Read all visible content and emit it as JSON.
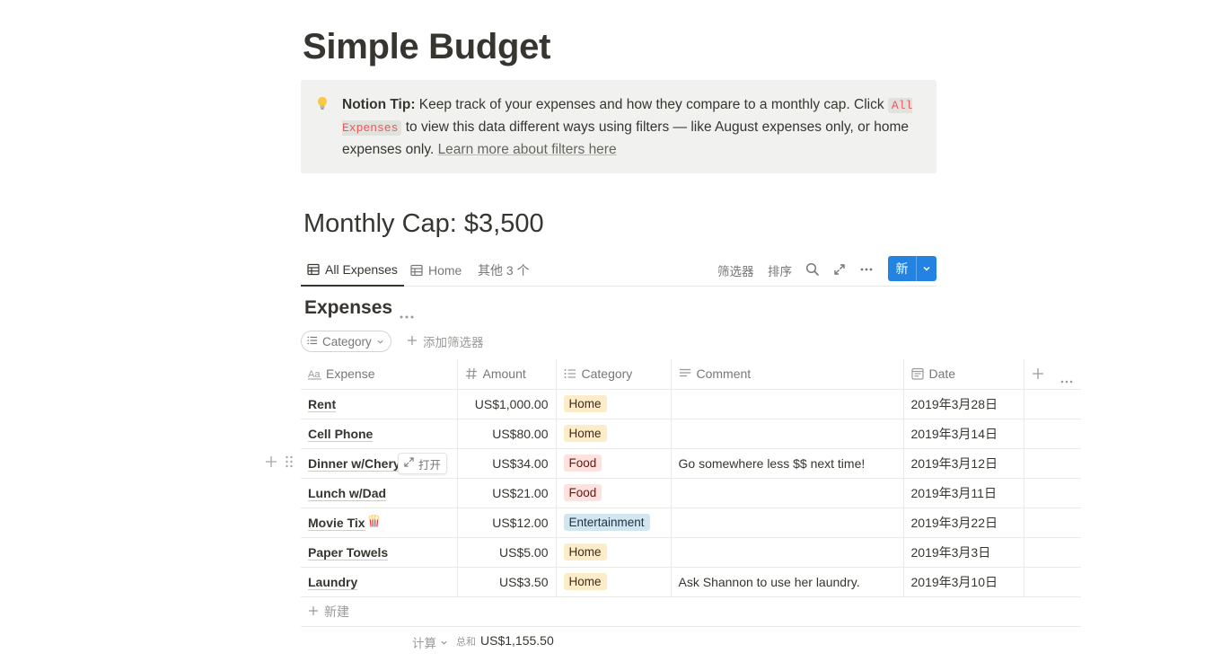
{
  "page": {
    "title": "Simple Budget"
  },
  "callout": {
    "icon": "lightbulb-icon",
    "bold": "Notion Tip:",
    "text1": " Keep track of your expenses and how they compare to a monthly cap. Click ",
    "code": "All Expenses",
    "text2": " to view this data different ways using filters — like August expenses only, or home expenses only. ",
    "link": "Learn more about filters here"
  },
  "heading": "Monthly Cap: $3,500",
  "views": {
    "tabs": [
      {
        "label": "All Expenses",
        "icon": "table-icon",
        "active": true
      },
      {
        "label": "Home",
        "icon": "table-icon",
        "active": false
      },
      {
        "label": "其他 3 个",
        "active": false
      }
    ],
    "filter_label": "筛选器",
    "sort_label": "排序",
    "new_label": "新"
  },
  "database": {
    "title": "Expenses",
    "filter_pill": "Category",
    "add_filter": "添加筛选器",
    "columns": [
      {
        "label": "Expense",
        "icon": "text-property-icon"
      },
      {
        "label": "Amount",
        "icon": "number-property-icon"
      },
      {
        "label": "Category",
        "icon": "select-property-icon"
      },
      {
        "label": "Comment",
        "icon": "text-lines-icon"
      },
      {
        "label": "Date",
        "icon": "calendar-icon"
      }
    ],
    "rows": [
      {
        "expense": "Rent",
        "amount": "US$1,000.00",
        "category": "Home",
        "comment": "",
        "date": "2019年3月28日"
      },
      {
        "expense": "Cell Phone",
        "amount": "US$80.00",
        "category": "Home",
        "comment": "",
        "date": "2019年3月14日"
      },
      {
        "expense": "Dinner w/Chery",
        "amount": "US$34.00",
        "category": "Food",
        "comment": "Go somewhere less $$ next time!",
        "date": "2019年3月12日"
      },
      {
        "expense": "Lunch w/Dad",
        "amount": "US$21.00",
        "category": "Food",
        "comment": "",
        "date": "2019年3月11日"
      },
      {
        "expense": "Movie Tix",
        "amount": "US$12.00",
        "category": "Entertainment",
        "comment": "",
        "date": "2019年3月22日",
        "emoji": "popcorn-icon"
      },
      {
        "expense": "Paper Towels",
        "amount": "US$5.00",
        "category": "Home",
        "comment": "",
        "date": "2019年3月3日"
      },
      {
        "expense": "Laundry",
        "amount": "US$3.50",
        "category": "Home",
        "comment": "Ask Shannon to use her laundry.",
        "date": "2019年3月10日"
      }
    ],
    "open_label": "打开",
    "new_row": "新建",
    "calc_label": "计算",
    "sum_label": "总和",
    "sum_value": "US$1,155.50"
  },
  "colors": {
    "Home": {
      "bg": "#fdecc8",
      "fg": "#402c1b"
    },
    "Food": {
      "bg": "#ffe2dd",
      "fg": "#5d1715"
    },
    "Entertainment": {
      "bg": "#d3e5ef",
      "fg": "#183347"
    },
    "accent": "#2383e2"
  }
}
